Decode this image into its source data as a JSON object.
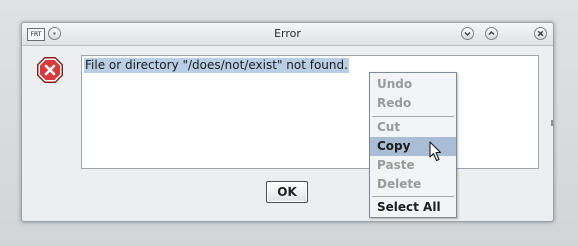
{
  "window": {
    "title": "Error",
    "app_icon_label": "FRT"
  },
  "message": {
    "text": "File or directory \"/does/not/exist\" not found."
  },
  "buttons": {
    "ok_label": "OK"
  },
  "context_menu": {
    "items": [
      {
        "label": "Undo",
        "enabled": false
      },
      {
        "label": "Redo",
        "enabled": false
      },
      {
        "label": "Cut",
        "enabled": false
      },
      {
        "label": "Copy",
        "enabled": true,
        "highlighted": true
      },
      {
        "label": "Paste",
        "enabled": false
      },
      {
        "label": "Delete",
        "enabled": false
      },
      {
        "label": "Select All",
        "enabled": true
      }
    ]
  },
  "icons": {
    "error": "error-stop-icon",
    "cursor": "hand-pointer-icon"
  },
  "colors": {
    "selection": "#b8cfe5",
    "menu_highlight": "#a9bed5",
    "error_red": "#d83a3a"
  }
}
